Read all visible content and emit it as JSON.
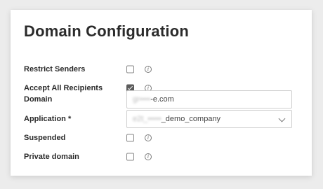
{
  "title": "Domain Configuration",
  "fields": {
    "restrict_senders": {
      "label": "Restrict Senders",
      "checked": false,
      "info_icon": "info-icon"
    },
    "accept_all_recipients": {
      "label": "Accept All Recipients",
      "checked": true,
      "info_icon": "info-icon"
    },
    "domain": {
      "label": "Domain",
      "value_redacted": "gr••••",
      "value_visible": "-e.com"
    },
    "application": {
      "label": "Application *",
      "value_redacted": "e2t_•••••",
      "value_visible": "_demo_company",
      "dropdown_icon": "chevron-down-icon"
    },
    "suspended": {
      "label": "Suspended",
      "checked": false,
      "info_icon": "info-icon"
    },
    "private_domain": {
      "label": "Private domain",
      "checked": false,
      "info_icon": "info-icon"
    }
  },
  "info_glyph": "i"
}
